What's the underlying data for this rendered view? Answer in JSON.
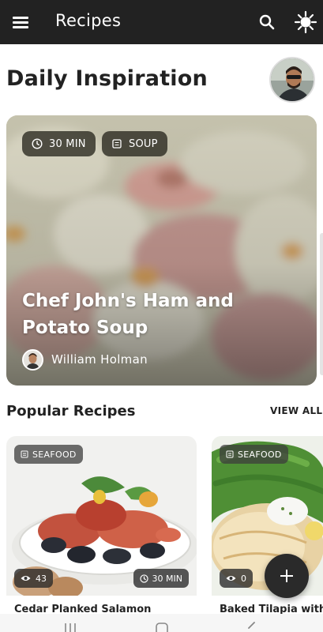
{
  "app_bar": {
    "title": "Recipes",
    "menu_icon": "hamburger-menu-icon",
    "search_icon": "search-icon",
    "theme_icon": "brightness-icon"
  },
  "inspiration": {
    "heading": "Daily Inspiration",
    "featured": {
      "time_chip": "30 MIN",
      "category_chip": "SOUP",
      "title": "Chef John's Ham and Potato Soup",
      "author": "William Holman"
    }
  },
  "popular": {
    "heading": "Popular Recipes",
    "view_all": "VIEW ALL",
    "cards": [
      {
        "category": "SEAFOOD",
        "views": "43",
        "time": "30 MIN",
        "name": "Cedar Planked Salamon"
      },
      {
        "category": "SEAFOOD",
        "views": "0",
        "name": "Baked Tilapia with D"
      }
    ]
  },
  "fab": {
    "icon": "plus-icon"
  },
  "colors": {
    "app_bar": "#222222",
    "chip_bg": "#2c2a22",
    "fab": "#2a2a2a"
  }
}
